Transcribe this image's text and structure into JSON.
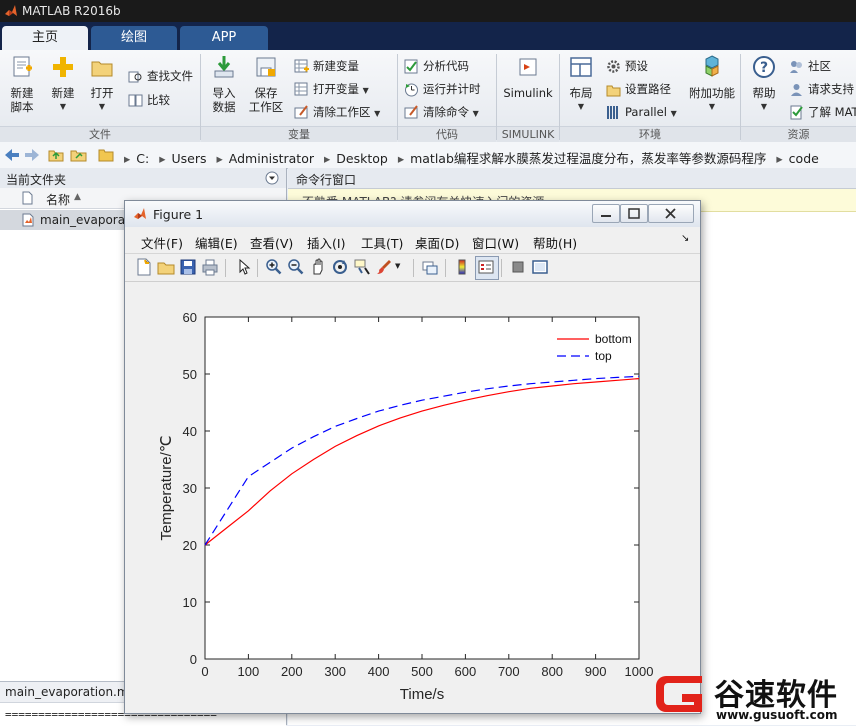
{
  "window": {
    "title": "MATLAB R2016b"
  },
  "tabs": [
    {
      "label": "主页"
    },
    {
      "label": "绘图"
    },
    {
      "label": "APP"
    }
  ],
  "ribbon": {
    "new_script": {
      "line1": "新建",
      "line2": "脚本"
    },
    "new": "新建",
    "open": "打开",
    "find_files": "查找文件",
    "compare": "比较",
    "import_data": {
      "line1": "导入",
      "line2": "数据"
    },
    "save_workspace": {
      "line1": "保存",
      "line2": "工作区"
    },
    "new_variable": "新建变量",
    "open_variable": "打开变量",
    "clear_workspace": "清除工作区",
    "analyze_code": "分析代码",
    "run_and_time": "运行并计时",
    "clear_commands": "清除命令",
    "simulink": "Simulink",
    "layout": "布局",
    "preferences": "预设",
    "set_path": "设置路径",
    "parallel": "Parallel",
    "addons": "附加功能",
    "help": "帮助",
    "community": "社区",
    "request_support": "请求支持",
    "learn_matlab": "了解 MAT",
    "groups": {
      "file": "文件",
      "variable": "变量",
      "code": "代码",
      "simulink": "SIMULINK",
      "environment": "环境",
      "resources": "资源"
    }
  },
  "address": {
    "sep": "▸",
    "path": [
      "C:",
      "Users",
      "Administrator",
      "Desktop",
      "matlab编程求解水膜蒸发过程温度分布，蒸发率等参数源码程序",
      "code"
    ]
  },
  "left_panel": {
    "title": "当前文件夹",
    "column_name": "名称",
    "sort_arrow": "▲",
    "file": "main_evaporat",
    "details_file": "main_evaporation.m",
    "details_line": "================================"
  },
  "command_window": {
    "title": "命令行窗口",
    "notice": "不熟悉 MATLAB? 请参阅有关快速入门的资源。"
  },
  "figure": {
    "title": "Figure 1",
    "menu": [
      "文件(F)",
      "编辑(E)",
      "查看(V)",
      "插入(I)",
      "工具(T)",
      "桌面(D)",
      "窗口(W)",
      "帮助(H)"
    ],
    "menu_arrow": "↘",
    "toolbar_icons": [
      "new-figure-icon",
      "open-icon",
      "save-icon",
      "print-icon",
      "pointer-icon",
      "zoom-in-icon",
      "zoom-out-icon",
      "pan-icon",
      "rotate-icon",
      "data-cursor-icon",
      "brush-icon",
      "link-icon",
      "colorbar-icon",
      "legend-icon",
      "hide-plot-tools-icon",
      "show-plot-tools-icon"
    ]
  },
  "watermark": {
    "brand": "谷速软件",
    "url": "www.gusuoft.com"
  },
  "chart_data": {
    "type": "line",
    "title": "",
    "xlabel": "Time/s",
    "ylabel": "Temperature/℃",
    "xlim": [
      0,
      1000
    ],
    "ylim": [
      0,
      60
    ],
    "xticks": [
      0,
      100,
      200,
      300,
      400,
      500,
      600,
      700,
      800,
      900,
      1000
    ],
    "yticks": [
      0,
      10,
      20,
      30,
      40,
      50,
      60
    ],
    "grid": false,
    "legend_position": "top-right",
    "series": [
      {
        "name": "bottom",
        "color": "#ff0000",
        "style": "solid",
        "x": [
          0,
          50,
          100,
          150,
          200,
          250,
          300,
          350,
          400,
          450,
          500,
          550,
          600,
          650,
          700,
          750,
          800,
          850,
          900,
          950,
          1000
        ],
        "y": [
          20,
          23,
          26,
          29.5,
          32.5,
          35,
          37.3,
          39.2,
          40.9,
          42.3,
          43.5,
          44.5,
          45.4,
          46.2,
          46.9,
          47.5,
          47.9,
          48.3,
          48.6,
          48.9,
          49.2
        ]
      },
      {
        "name": "top",
        "color": "#0000ff",
        "style": "dashed",
        "x": [
          0,
          50,
          100,
          150,
          200,
          250,
          300,
          350,
          400,
          450,
          500,
          550,
          600,
          650,
          700,
          750,
          800,
          850,
          900,
          950,
          1000
        ],
        "y": [
          20,
          26,
          32,
          34.5,
          37,
          39,
          40.8,
          42.2,
          43.5,
          44.5,
          45.4,
          46.1,
          46.8,
          47.4,
          47.9,
          48.3,
          48.6,
          48.9,
          49.2,
          49.4,
          49.6
        ]
      }
    ]
  }
}
